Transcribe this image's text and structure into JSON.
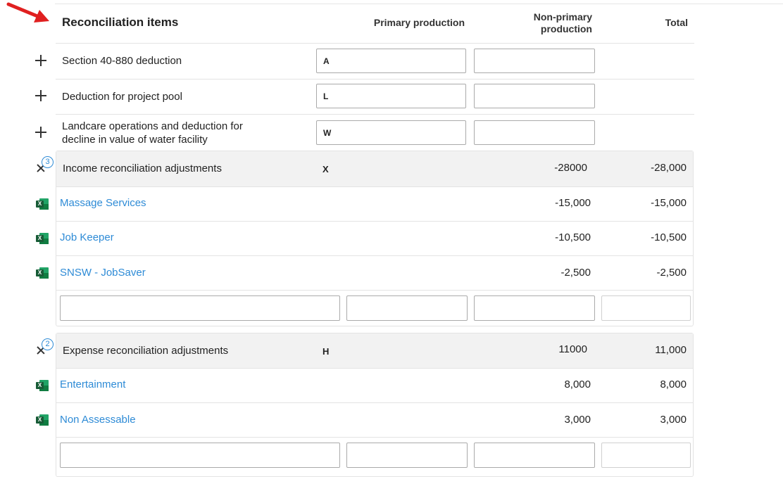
{
  "header": {
    "title": "Reconciliation items",
    "col_primary": "Primary production",
    "col_nonprimary_line1": "Non-primary",
    "col_nonprimary_line2": "production",
    "col_total": "Total"
  },
  "items": [
    {
      "label": "Section 40-880 deduction",
      "code": "A"
    },
    {
      "label": "Deduction for project pool",
      "code": "L"
    },
    {
      "label_line1": "Landcare operations and deduction for",
      "label_line2": "decline in value of water facility",
      "code": "W"
    }
  ],
  "income": {
    "label": "Income reconciliation adjustments",
    "badge": "3",
    "code": "X",
    "nonprimary": "-28000",
    "total": "-28,000",
    "rows": [
      {
        "label": "Massage Services",
        "nonprimary": "-15,000",
        "total": "-15,000"
      },
      {
        "label": "Job Keeper",
        "nonprimary": "-10,500",
        "total": "-10,500"
      },
      {
        "label": "SNSW - JobSaver",
        "nonprimary": "-2,500",
        "total": "-2,500"
      }
    ]
  },
  "expense": {
    "label": "Expense reconciliation adjustments",
    "badge": "2",
    "code": "H",
    "nonprimary": "11000",
    "total": "11,000",
    "rows": [
      {
        "label": "Entertainment",
        "nonprimary": "8,000",
        "total": "8,000"
      },
      {
        "label": "Non Assessable",
        "nonprimary": "3,000",
        "total": "3,000"
      }
    ]
  },
  "icons": {
    "arrow": "red-pointer-arrow",
    "add": "plus-icon",
    "collapse": "close-icon",
    "excel": "excel-icon"
  },
  "colors": {
    "link": "#2e8bd6",
    "group_header_bg": "#f2f2f2",
    "arrow": "#e02020",
    "excel_green": "#21a366"
  }
}
